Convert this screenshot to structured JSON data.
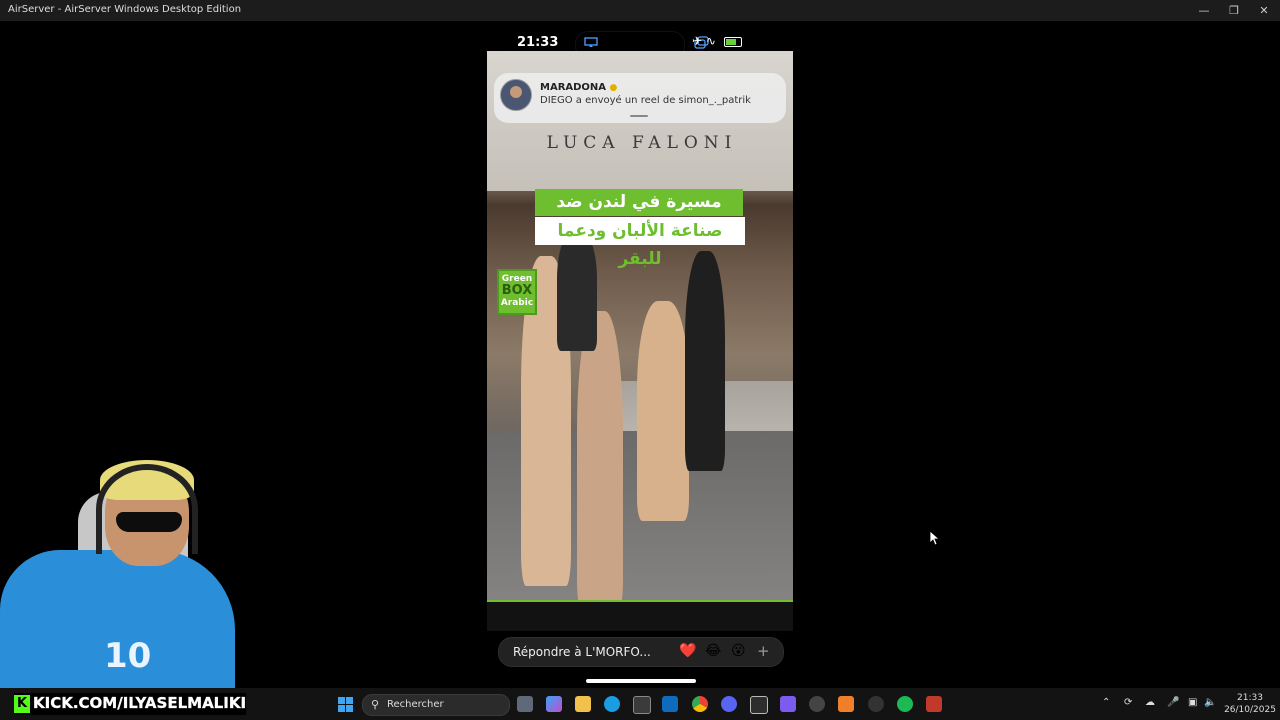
{
  "window": {
    "title": "AirServer - AirServer Windows Desktop Edition",
    "minimize_icon": "minimize-icon",
    "restore_icon": "restore-icon",
    "close_icon": "close-icon"
  },
  "phone": {
    "status_time": "21:33",
    "notification": {
      "sender": "MARADONA",
      "message": "DIEGO a envoyé un reel de simon_._patrik"
    },
    "video": {
      "shop_sign": "LUCA FALONI",
      "banner_line1": "مسيرة في لندن ضد",
      "banner_line2": "صناعة الألبان ودعما للبقر",
      "logo_line1": "Green",
      "logo_line2": "BOX",
      "logo_line3": "Arabic"
    },
    "reply_placeholder": "Répondre à L'MORFO...",
    "reactions": [
      "❤️",
      "😂",
      "😮",
      "+"
    ]
  },
  "webcam": {
    "shirt_number": "10"
  },
  "overlay": {
    "kick_url": "KICK.COM/ILYASELMALIKI"
  },
  "taskbar": {
    "search_label": "Rechercher",
    "clock_time": "21:33",
    "clock_date": "26/10/2025"
  },
  "colors": {
    "accent_green": "#6fbe2f",
    "kick_green": "#53fc18"
  }
}
